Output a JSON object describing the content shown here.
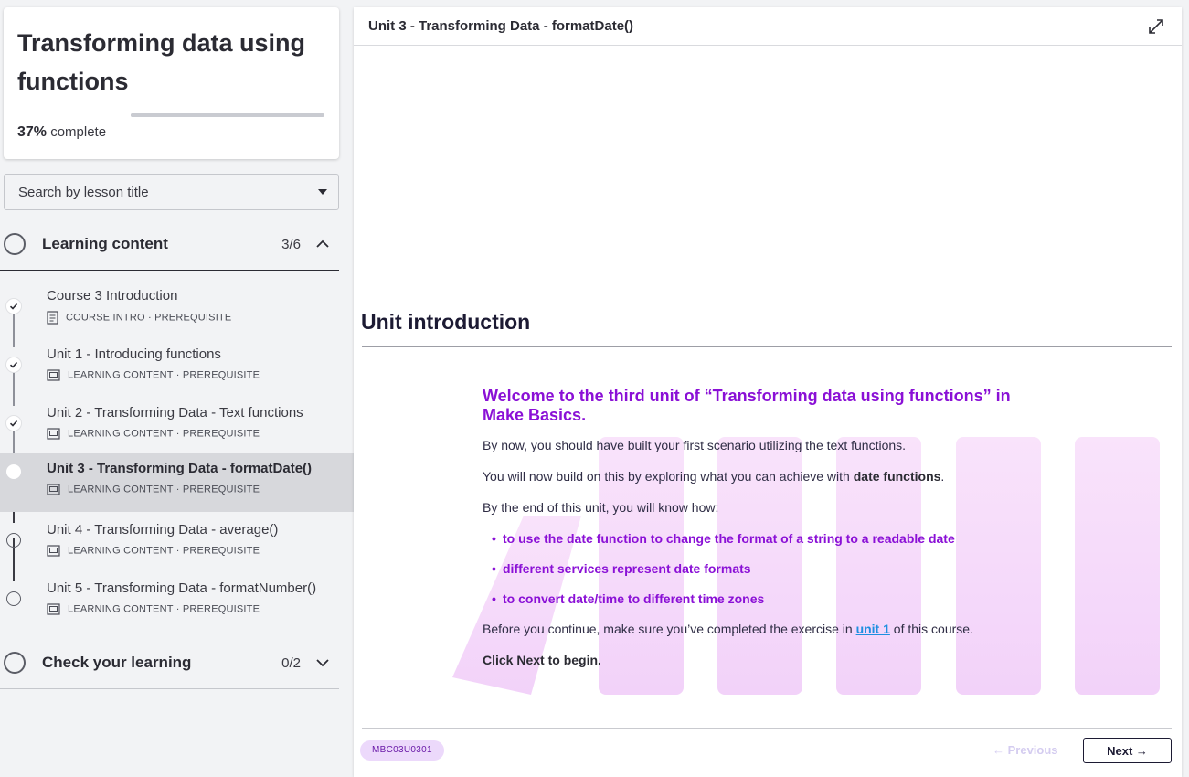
{
  "course": {
    "title": "Transforming data using functions",
    "progress_percent": 37,
    "progress_value": "37%",
    "progress_suffix": "complete"
  },
  "search": {
    "label": "Search by lesson title"
  },
  "sections": [
    {
      "title": "Learning content",
      "count": "3/6",
      "expanded": true,
      "lessons": [
        {
          "title": "Course 3 Introduction",
          "meta": "COURSE INTRO · PREREQUISITE",
          "status": "done",
          "icon": "document-icon"
        },
        {
          "title": "Unit 1 - Introducing functions",
          "meta": "LEARNING CONTENT · PREREQUISITE",
          "status": "done",
          "icon": "slides-icon"
        },
        {
          "title": "Unit 2 - Transforming Data - Text functions",
          "meta": "LEARNING CONTENT · PREREQUISITE",
          "status": "done",
          "icon": "slides-icon"
        },
        {
          "title": "Unit 3 - Transforming Data - formatDate()",
          "meta": "LEARNING CONTENT · PREREQUISITE",
          "status": "current",
          "icon": "slides-icon"
        },
        {
          "title": "Unit 4 - Transforming Data - average()",
          "meta": "LEARNING CONTENT · PREREQUISITE",
          "status": "todo",
          "icon": "slides-icon"
        },
        {
          "title": "Unit 5 - Transforming Data - formatNumber()",
          "meta": "LEARNING CONTENT · PREREQUISITE",
          "status": "todo",
          "icon": "slides-icon"
        }
      ]
    },
    {
      "title": "Check your learning",
      "count": "0/2",
      "expanded": false
    }
  ],
  "main": {
    "topbar_title": "Unit 3 - Transforming Data - formatDate()",
    "heading": "Unit introduction",
    "welcome": "Welcome to the third unit of “Transforming data using functions” in Make Basics.",
    "para1": "By now, you should have built your first scenario utilizing the text functions.",
    "para2_prefix": "You will now build on this by exploring what you can achieve with ",
    "para2_bold": "date functions",
    "para2_suffix": ".",
    "para3": "By the end of this unit, you will know how:",
    "bullets": [
      "to use the date function to change the format of a string to a readable date",
      "different services represent date formats",
      "to convert date/time to different time zones"
    ],
    "para4_prefix": "Before you continue, make sure you’ve completed the exercise in ",
    "para4_link": "unit 1",
    "para4_suffix": " of this course.",
    "cta": "Click Next to begin.",
    "code": "MBC03U0301",
    "prev_label": "← Previous",
    "next_label": "Next →"
  },
  "colors": {
    "accent_purple": "#8a10d6",
    "link_blue": "#1e8fe0",
    "active_row": "#d7d8dc",
    "decor_pink": "#f6d8fb"
  }
}
